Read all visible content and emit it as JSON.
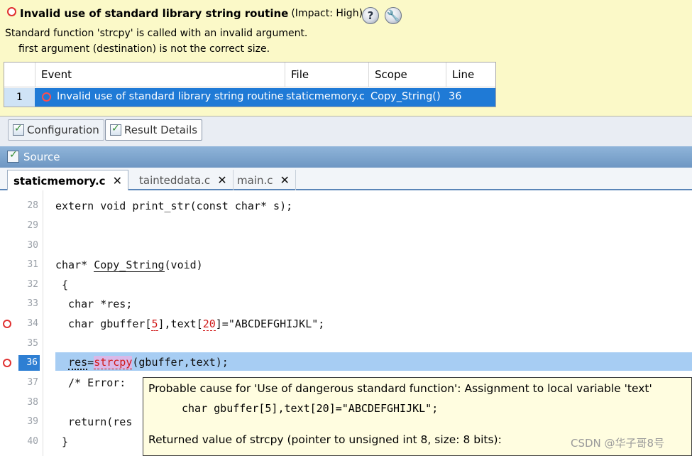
{
  "issue": {
    "title": "Invalid use of standard library string routine",
    "impact": "(Impact: High)",
    "description": "Standard function 'strcpy' is called with an invalid argument.",
    "detail": "first argument (destination) is not the correct size.",
    "help_icon": "question-icon",
    "tools_icon": "wrench-icon"
  },
  "events_table": {
    "columns": [
      "Event",
      "File",
      "Scope",
      "Line"
    ],
    "rows": [
      {
        "index": "1",
        "event": "Invalid use of standard library string routine",
        "file": "staticmemory.c",
        "scope": "Copy_String()",
        "line": "36"
      }
    ]
  },
  "panel_tabs": [
    {
      "label": "Configuration",
      "active": false
    },
    {
      "label": "Result Details",
      "active": true
    }
  ],
  "source": {
    "header": "Source",
    "file_tabs": [
      {
        "label": "staticmemory.c",
        "active": true
      },
      {
        "label": "tainteddata.c",
        "active": false
      },
      {
        "label": "main.c",
        "active": false
      }
    ],
    "close_glyph": "✕"
  },
  "code": {
    "line_numbers": [
      "28",
      "29",
      "30",
      "31",
      "32",
      "33",
      "34",
      "35",
      "36",
      "37",
      "38",
      "39",
      "40"
    ],
    "current_line": "36",
    "lines": {
      "l28": "extern void print_str(const char* s);",
      "l31_a": "char* ",
      "l31_b": "Copy_String",
      "l31_c": "(void)",
      "l32": " {",
      "l33": "  char *res;",
      "l34_a": "  char gbuffer[",
      "l34_b": "5",
      "l34_c": "],text[",
      "l34_d": "20",
      "l34_e": "]=\"ABCDEFGHIJKL\";",
      "l36_a": "  ",
      "l36_b": "res",
      "l36_c": "=",
      "l36_d": "strcpy",
      "l36_e": "(gbuffer,text);",
      "l37": "  /* Error:",
      "l39": "  return(res",
      "l40": " }"
    }
  },
  "tooltip": {
    "line1": "Probable cause for 'Use of dangerous standard function': Assignment to local variable 'text'",
    "line2": "char gbuffer[5],text[20]=\"ABCDEFGHIJKL\";",
    "line3": "Returned value of strcpy (pointer to unsigned int 8, size: 8 bits):"
  },
  "watermark": "CSDN @华子哥8号",
  "colors": {
    "issue_bg": "#fbf9c8",
    "selection": "#1f7ad6",
    "current_line": "#a7cdf3",
    "error_red": "#d01818"
  }
}
